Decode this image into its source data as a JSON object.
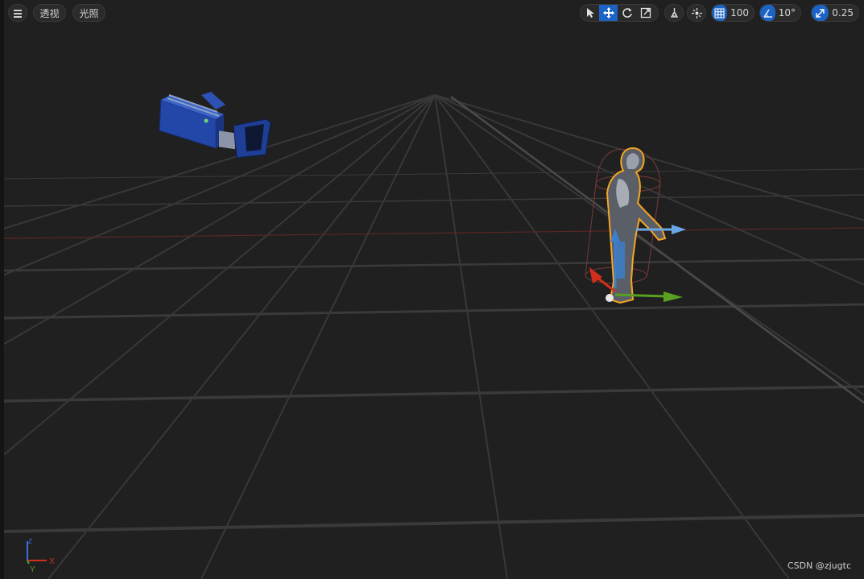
{
  "toolbar": {
    "view_mode_label": "透视",
    "lighting_label": "光照",
    "grid_snap_value": "100",
    "rotation_snap_value": "10°",
    "scale_snap_value": "0.25"
  },
  "axis_widget": {
    "x_label": "X",
    "y_label": "Y",
    "z_label": "Z"
  },
  "watermark": "CSDN @zjugtc",
  "colors": {
    "active_blue": "#1b63c4",
    "background": "#202020",
    "selection_outline": "#f5a623",
    "axis_x": "#d0301a",
    "axis_y": "#5aa020",
    "axis_z": "#3a7fd0"
  },
  "icons": [
    "menu-icon",
    "select-icon",
    "move-icon",
    "rotate-icon",
    "scale-icon",
    "surface-snap-icon",
    "transform-icon",
    "grid-icon",
    "angle-icon",
    "scale-snap-icon",
    "camera-icon",
    "character-mannequin"
  ]
}
